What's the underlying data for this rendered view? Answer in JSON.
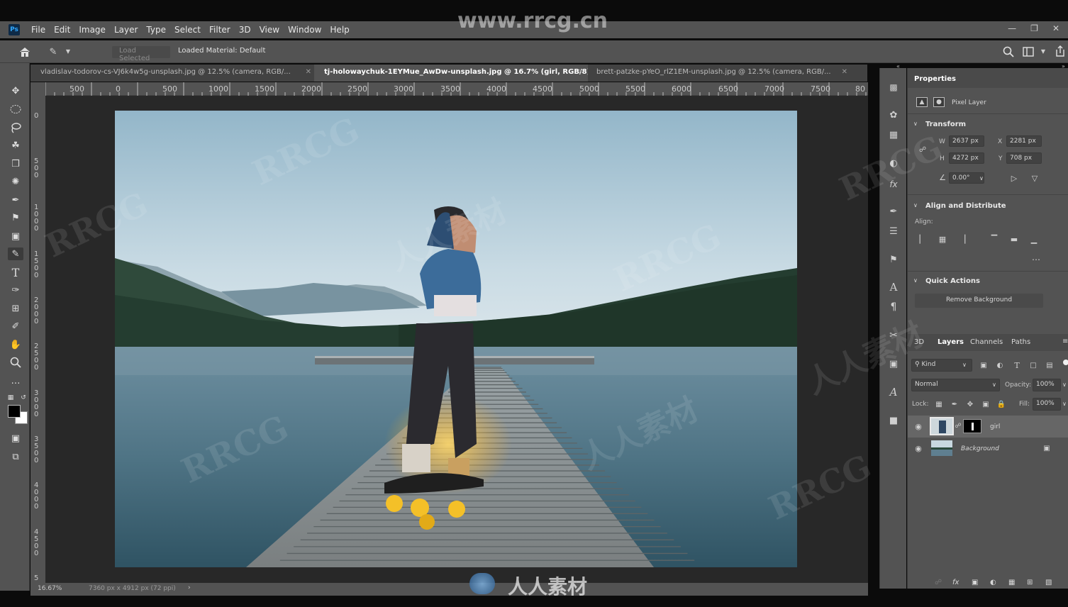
{
  "watermark_url": "www.rrcg.cn",
  "watermarks": {
    "rrcg": "RRCG",
    "cn": "人人素材",
    "footer": "人人素材"
  },
  "app": {
    "logo": "Ps"
  },
  "menu": [
    "File",
    "Edit",
    "Image",
    "Layer",
    "Type",
    "Select",
    "Filter",
    "3D",
    "View",
    "Window",
    "Help"
  ],
  "options": {
    "load_selected": "Load Selected",
    "loaded_material": "Loaded Material: Default"
  },
  "tabs": [
    {
      "label": "vladislav-todorov-cs-VJ6k4w5g-unsplash.jpg @ 12.5% (camera, RGB/..."
    },
    {
      "label": "tj-holowaychuk-1EYMue_AwDw-unsplash.jpg @ 16.7% (girl, RGB/8) *"
    },
    {
      "label": "brett-patzke-pYeO_rlZ1EM-unsplash.jpg @ 12.5% (camera, RGB/..."
    }
  ],
  "ruler_top": [
    "500",
    "0",
    "500",
    "1000",
    "1500",
    "2000",
    "2500",
    "3000",
    "3500",
    "4000",
    "4500",
    "5000",
    "5500",
    "6000",
    "6500",
    "7000",
    "7500",
    "80"
  ],
  "ruler_left": [
    "0",
    "5\n0\n0",
    "1\n0\n0\n0",
    "1\n5\n0\n0",
    "2\n0\n0\n0",
    "2\n5\n0\n0",
    "3\n0\n0\n0",
    "3\n5\n0\n0",
    "4\n0\n0\n0",
    "4\n5\n0\n0",
    "5"
  ],
  "status": {
    "zoom": "16.67%",
    "doc_size": "7360 px x 4912 px (72 ppi)",
    "arrow": "›"
  },
  "properties": {
    "title": "Properties",
    "layer_type": "Pixel Layer",
    "transform": {
      "title": "Transform",
      "w_label": "W",
      "w": "2637 px",
      "x_label": "X",
      "x": "2281 px",
      "h_label": "H",
      "h": "4272 px",
      "y_label": "Y",
      "y": "708 px",
      "angle": "0.00°"
    },
    "align": {
      "title": "Align and Distribute",
      "label": "Align:"
    },
    "quick_actions": {
      "title": "Quick Actions",
      "remove_bg": "Remove Background"
    }
  },
  "layers_panel": {
    "tabs": [
      "3D",
      "Layers",
      "Channels",
      "Paths"
    ],
    "kind": "Kind",
    "blend": "Normal",
    "opacity_label": "Opacity:",
    "opacity": "100%",
    "lock_label": "Lock:",
    "fill_label": "Fill:",
    "fill": "100%",
    "layers": [
      {
        "name": "girl"
      },
      {
        "name": "Background"
      }
    ],
    "footer_fx": "fx"
  },
  "colors": {
    "panel": "#535353",
    "dark": "#424242",
    "canvas_bg": "#282828",
    "accent": "#31a8ff"
  }
}
